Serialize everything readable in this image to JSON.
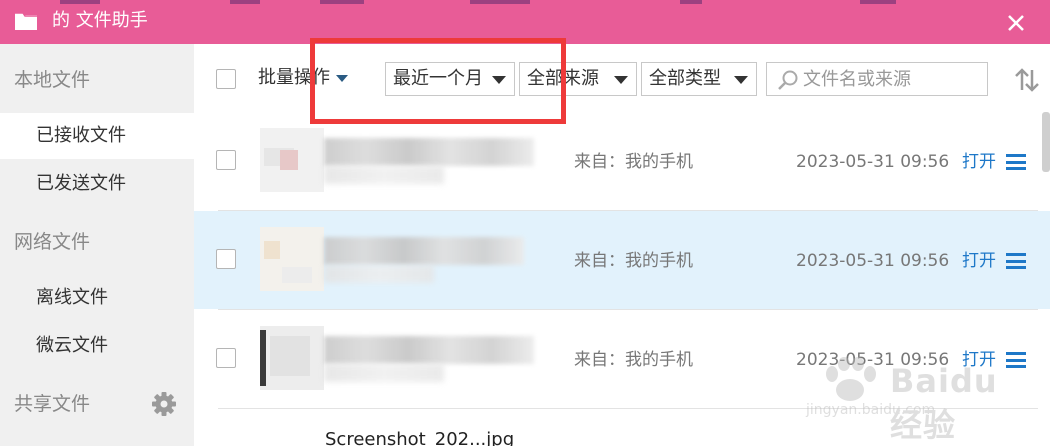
{
  "window": {
    "title": "的 文件助手",
    "close_glyph": "✕"
  },
  "sidebar": {
    "sections": [
      {
        "label": "本地文件"
      },
      {
        "label": "网络文件"
      },
      {
        "label": "共享文件"
      }
    ],
    "items": [
      {
        "label": "已接收文件",
        "active": true
      },
      {
        "label": "已发送文件",
        "active": false
      },
      {
        "label": "离线文件",
        "active": false
      },
      {
        "label": "微云文件",
        "active": false
      }
    ],
    "settings_icon": "gear-icon"
  },
  "toolbar": {
    "batch_label": "批量操作",
    "time_filter": "最近一个月",
    "source_filter": "全部来源",
    "type_filter": "全部类型",
    "search_placeholder": "文件名或来源",
    "sort_icon": "sort-icon"
  },
  "files": [
    {
      "source": "来自：我的手机",
      "date": "2023-05-31 09:56",
      "open_label": "打开",
      "selected": false
    },
    {
      "source": "来自：我的手机",
      "date": "2023-05-31 09:56",
      "open_label": "打开",
      "selected": true
    },
    {
      "source": "来自：我的手机",
      "date": "2023-05-31 09:56",
      "open_label": "打开",
      "selected": false
    }
  ],
  "partial_row": {
    "name": "Screenshot_202...jpg"
  },
  "watermark": {
    "brand": "Baidu 经验",
    "url": "jingyan.baidu.com"
  },
  "colors": {
    "titlebar": "#e85c97",
    "sidebar": "#f0f0f0",
    "selected_row": "#e2f2fc",
    "link": "#1e78c8",
    "highlight": "#ee3a3a"
  }
}
